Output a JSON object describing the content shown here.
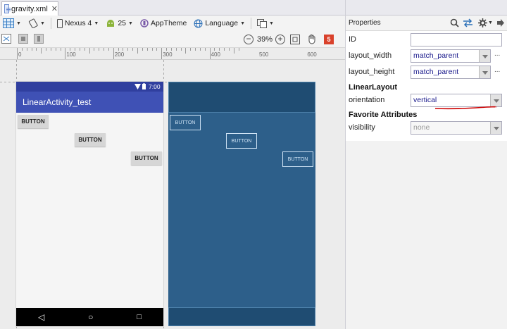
{
  "tab": {
    "label": "gravity.xml",
    "close": "✕"
  },
  "toolbar": {
    "device": "Nexus 4",
    "api": "25",
    "theme": "AppTheme",
    "language": "Language"
  },
  "zoom": {
    "level": "39%",
    "minus": "−",
    "plus": "+",
    "warnings": "5"
  },
  "ruler": {
    "labels": [
      "0",
      "100",
      "200",
      "300",
      "400",
      "500",
      "600"
    ]
  },
  "phone": {
    "time": "7:00",
    "app_title": "LinearActivity_test",
    "buttons": [
      "BUTTON",
      "BUTTON",
      "BUTTON"
    ],
    "nav": {
      "back": "◁",
      "home": "○",
      "recents": "□"
    }
  },
  "blueprint": {
    "buttons": [
      "BUTTON",
      "BUTTON",
      "BUTTON"
    ]
  },
  "properties": {
    "title": "Properties",
    "id_label": "ID",
    "id_value": "",
    "layout_width_label": "layout_width",
    "layout_width_value": "match_parent",
    "layout_height_label": "layout_height",
    "layout_height_value": "match_parent",
    "section_linear": "LinearLayout",
    "orientation_label": "orientation",
    "orientation_value": "vertical",
    "section_favorite": "Favorite Attributes",
    "visibility_label": "visibility",
    "visibility_value": "none",
    "more": "..."
  },
  "colors": {
    "status_bar": "#303f9f",
    "app_bar": "#3f51b5",
    "blueprint": "#2d5f8a",
    "underline": "#cc0000",
    "value_text": "#1a1a8c"
  }
}
